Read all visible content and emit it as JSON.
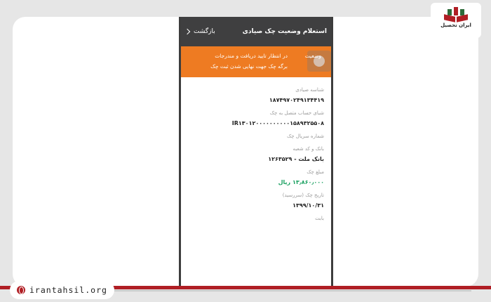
{
  "appbar": {
    "title": "استعلام وضعیت چک صیادی",
    "back_label": "بازگشت"
  },
  "banner": {
    "label": "وضعیت",
    "message": "در انتظار تایید دریافت و مندرجات برگه چک جهت نهایی شدن ثبت چک"
  },
  "fields": [
    {
      "label": "شناسه صیادی",
      "value": "۱۸۷۴۹۷۰۲۴۹۱۳۴۴۱۹"
    },
    {
      "label": "شبای حساب متصل به چک",
      "value": "IR۱۳۰۱۲۰۰۰۰۰۰۰۰۰۰۱۵۸۹۳۲۵۵۰۸"
    },
    {
      "label": "شماره سریال چک",
      "value": ""
    },
    {
      "label": "بانک و کد شعبه",
      "value": "بانک ملت - ۱۲۶۳۵۲۹"
    },
    {
      "label": "مبلغ چک",
      "value": "۱۳٫۸۶۰٫۰۰۰ ریال"
    },
    {
      "label": "تاریخ چک (سررسید)",
      "value": "۱۳۹۹/۱۰/۳۱"
    },
    {
      "label": "بابت",
      "value": ""
    }
  ],
  "site": {
    "url": "irantahsil.org"
  },
  "logo": {
    "name": "ایران تحصیل"
  },
  "colors": {
    "appbar": "#3f3f40",
    "banner": "#ee7b22",
    "amount": "#1aa060",
    "brand": "#b01e24"
  }
}
